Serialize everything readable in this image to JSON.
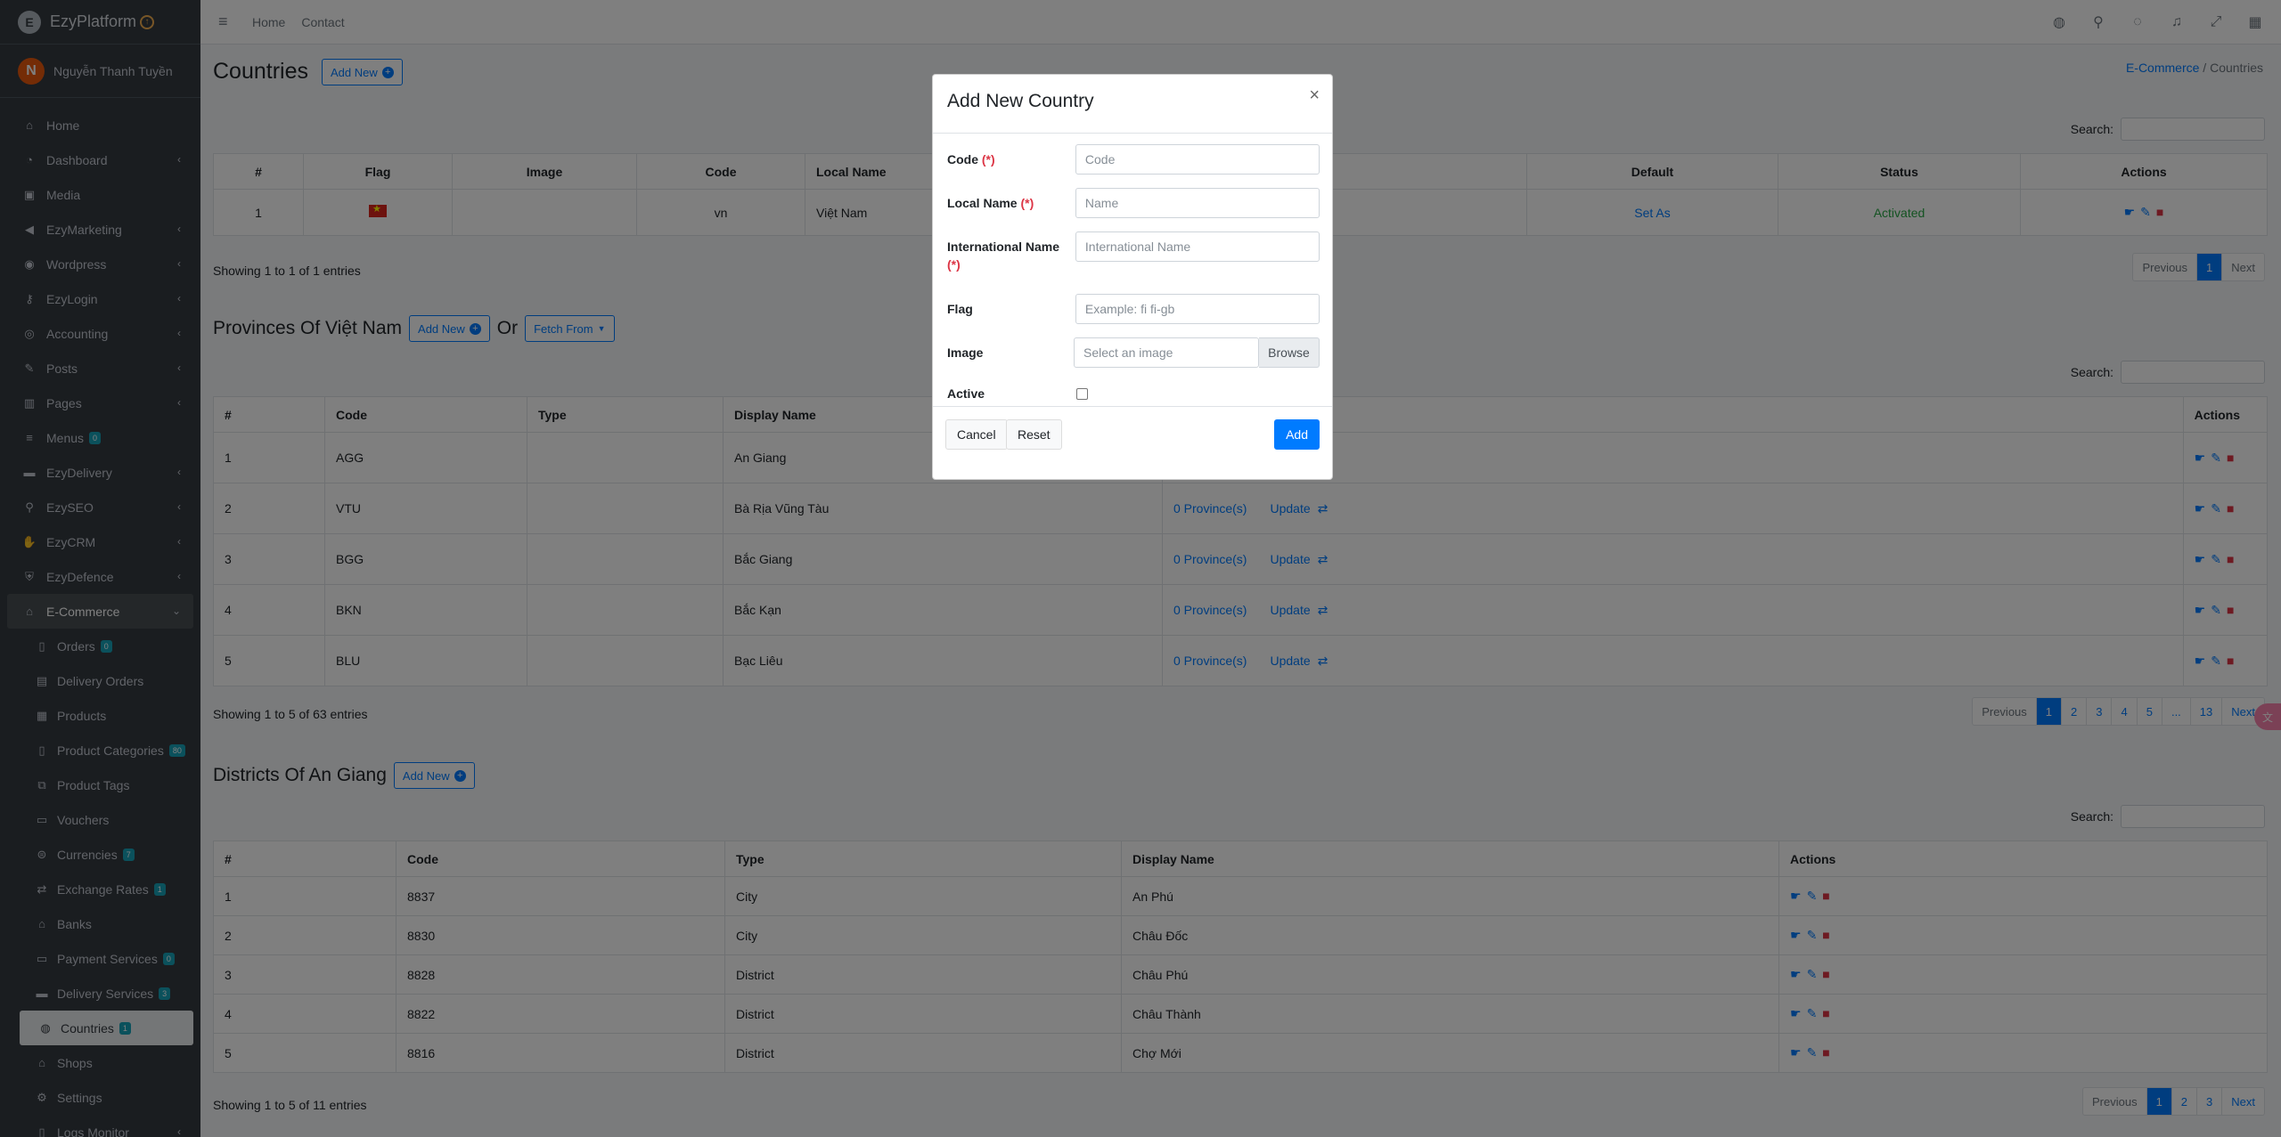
{
  "brand": {
    "name": "EzyPlatform",
    "initial": "E"
  },
  "user": {
    "initial": "N",
    "name": "Nguyễn Thanh Tuyền"
  },
  "sidebar": {
    "items": [
      {
        "label": "Home",
        "icon": "home-icon",
        "glyph": "⌂"
      },
      {
        "label": "Dashboard",
        "icon": "dashboard-icon",
        "glyph": "◔"
      },
      {
        "label": "Media",
        "icon": "image-icon",
        "glyph": "▣"
      },
      {
        "label": "EzyMarketing",
        "icon": "megaphone-icon",
        "glyph": "◀"
      },
      {
        "label": "Wordpress",
        "icon": "gauge-icon",
        "glyph": "◉"
      },
      {
        "label": "EzyLogin",
        "icon": "user-lock-icon",
        "glyph": "⚷"
      },
      {
        "label": "Accounting",
        "icon": "database-icon",
        "glyph": "◎"
      },
      {
        "label": "Posts",
        "icon": "edit-icon",
        "glyph": "✎"
      },
      {
        "label": "Pages",
        "icon": "columns-icon",
        "glyph": "▥"
      },
      {
        "label": "Menus",
        "icon": "bars-icon",
        "glyph": "≡",
        "badge": "0"
      },
      {
        "label": "EzyDelivery",
        "icon": "truck-icon",
        "glyph": "▬"
      },
      {
        "label": "EzySEO",
        "icon": "search-icon",
        "glyph": "⚲"
      },
      {
        "label": "EzyCRM",
        "icon": "handshake-icon",
        "glyph": "✋"
      },
      {
        "label": "EzyDefence",
        "icon": "shield-icon",
        "glyph": "⛨"
      },
      {
        "label": "E-Commerce",
        "icon": "store-icon",
        "glyph": "⌂"
      }
    ],
    "sub_items": [
      {
        "label": "Orders",
        "icon": "file-icon",
        "glyph": "▯",
        "badge": "0"
      },
      {
        "label": "Delivery Orders",
        "icon": "dolly-icon",
        "glyph": "▤"
      },
      {
        "label": "Products",
        "icon": "boxes-icon",
        "glyph": "▦"
      },
      {
        "label": "Product Categories",
        "icon": "file-alt-icon",
        "glyph": "▯",
        "badge": "80"
      },
      {
        "label": "Product Tags",
        "icon": "tags-icon",
        "glyph": "⧉"
      },
      {
        "label": "Vouchers",
        "icon": "ticket-icon",
        "glyph": "▭"
      },
      {
        "label": "Currencies",
        "icon": "coins-icon",
        "glyph": "⊜",
        "badge": "7"
      },
      {
        "label": "Exchange Rates",
        "icon": "exchange-icon",
        "glyph": "⇄",
        "badge": "1"
      },
      {
        "label": "Banks",
        "icon": "bank-icon",
        "glyph": "⌂"
      },
      {
        "label": "Payment Services",
        "icon": "credit-card-icon",
        "glyph": "▭",
        "badge": "0"
      },
      {
        "label": "Delivery Services",
        "icon": "truck-icon",
        "glyph": "▬",
        "badge": "3"
      },
      {
        "label": "Countries",
        "icon": "globe-icon",
        "glyph": "◍",
        "badge": "1"
      },
      {
        "label": "Shops",
        "icon": "shop-icon",
        "glyph": "⌂"
      },
      {
        "label": "Settings",
        "icon": "gear-icon",
        "glyph": "⚙"
      },
      {
        "label": "Logs Monitor",
        "icon": "clipboard-icon",
        "glyph": "▯"
      }
    ]
  },
  "topbar": {
    "links": [
      "Home",
      "Contact"
    ]
  },
  "page": {
    "title": "Countries",
    "add_new": "Add New",
    "breadcrumb": [
      "E-Commerce",
      "Countries"
    ],
    "search_label": "Search:"
  },
  "countries": {
    "headers": [
      "#",
      "Flag",
      "Image",
      "Code",
      "Local Name",
      "Default",
      "Status",
      "Actions"
    ],
    "rows": [
      {
        "num": "1",
        "code": "vn",
        "local": "Việt Nam",
        "default": "Set As",
        "status": "Activated"
      }
    ],
    "entries": "Showing 1 to 1 of 1 entries",
    "pagination": [
      "Previous",
      "1",
      "Next"
    ]
  },
  "provinces": {
    "title": "Provinces Of Việt Nam",
    "add_new": "Add New",
    "or": "Or",
    "fetch": "Fetch From",
    "headers": [
      "#",
      "Code",
      "Type",
      "Display Name",
      "Actions"
    ],
    "rows": [
      {
        "num": "1",
        "code": "AGG",
        "name": "An Giang",
        "count": "",
        "update": ""
      },
      {
        "num": "2",
        "code": "VTU",
        "name": "Bà Rịa Vũng Tàu",
        "count": "0 Province(s)",
        "update": "Update"
      },
      {
        "num": "3",
        "code": "BGG",
        "name": "Bắc Giang",
        "count": "0 Province(s)",
        "update": "Update"
      },
      {
        "num": "4",
        "code": "BKN",
        "name": "Bắc Kạn",
        "count": "0 Province(s)",
        "update": "Update"
      },
      {
        "num": "5",
        "code": "BLU",
        "name": "Bạc Liêu",
        "count": "0 Province(s)",
        "update": "Update"
      }
    ],
    "entries": "Showing 1 to 5 of 63 entries",
    "pagination": [
      "Previous",
      "1",
      "2",
      "3",
      "4",
      "5",
      "...",
      "13",
      "Next"
    ]
  },
  "districts": {
    "title": "Districts Of An Giang",
    "add_new": "Add New",
    "headers": [
      "#",
      "Code",
      "Type",
      "Display Name",
      "Actions"
    ],
    "rows": [
      {
        "num": "1",
        "code": "8837",
        "type": "City",
        "name": "An Phú"
      },
      {
        "num": "2",
        "code": "8830",
        "type": "City",
        "name": "Châu Đốc"
      },
      {
        "num": "3",
        "code": "8828",
        "type": "District",
        "name": "Châu Phú"
      },
      {
        "num": "4",
        "code": "8822",
        "type": "District",
        "name": "Châu Thành"
      },
      {
        "num": "5",
        "code": "8816",
        "type": "District",
        "name": "Chợ Mới"
      }
    ],
    "entries": "Showing 1 to 5 of 11 entries",
    "pagination": [
      "Previous",
      "1",
      "2",
      "3",
      "Next"
    ]
  },
  "modal": {
    "title": "Add New Country",
    "close": "×",
    "fields": {
      "code": {
        "label": "Code",
        "req": "(*)",
        "placeholder": "Code"
      },
      "local": {
        "label": "Local Name",
        "req": "(*)",
        "placeholder": "Name"
      },
      "intl": {
        "label": "International Name",
        "req": "(*)",
        "placeholder": "International Name"
      },
      "flag": {
        "label": "Flag",
        "placeholder": "Example: fi fi-gb"
      },
      "image": {
        "label": "Image",
        "placeholder": "Select an image",
        "browse": "Browse"
      },
      "active": {
        "label": "Active"
      }
    },
    "cancel": "Cancel",
    "reset": "Reset",
    "add": "Add"
  }
}
